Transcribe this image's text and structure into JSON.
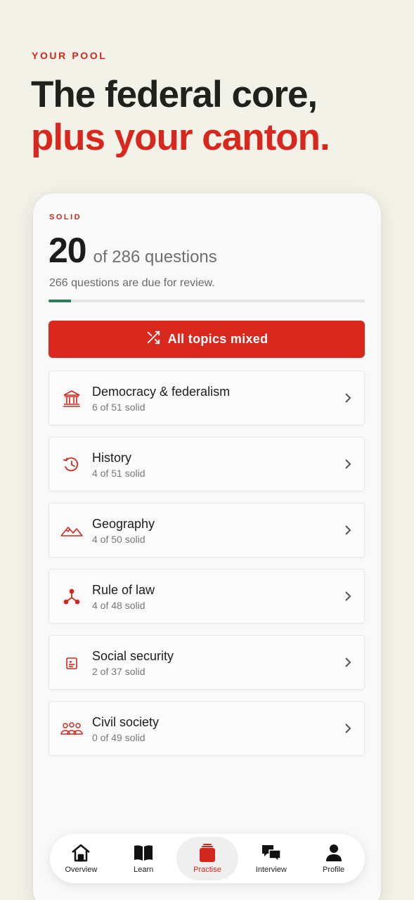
{
  "header": {
    "eyebrow": "YOUR POOL",
    "headline_line1": "The federal core,",
    "headline_line2": "plus your canton."
  },
  "summary": {
    "label": "SOLID",
    "solid_count": "20",
    "of_text": "of 286 questions",
    "due_text": "266 questions are due for review.",
    "progress_fraction": 0.07
  },
  "mix_button": {
    "label": "All topics mixed",
    "icon": "shuffle-icon"
  },
  "topics": [
    {
      "name": "Democracy & federalism",
      "sub": "6 of 51 solid",
      "icon": "building-columns-icon"
    },
    {
      "name": "History",
      "sub": "4 of 51 solid",
      "icon": "history-clock-icon"
    },
    {
      "name": "Geography",
      "sub": "4 of 50 solid",
      "icon": "mountains-icon"
    },
    {
      "name": "Rule of law",
      "sub": "4 of 48 solid",
      "icon": "network-nodes-icon"
    },
    {
      "name": "Social security",
      "sub": "2 of 37 solid",
      "icon": "card-heart-icon"
    },
    {
      "name": "Civil society",
      "sub": "0 of 49 solid",
      "icon": "people-group-icon"
    }
  ],
  "tabbar": [
    {
      "label": "Overview",
      "icon": "home-icon",
      "active": false
    },
    {
      "label": "Learn",
      "icon": "book-icon",
      "active": false
    },
    {
      "label": "Practise",
      "icon": "cards-icon",
      "active": true
    },
    {
      "label": "Interview",
      "icon": "chat-bubbles-icon",
      "active": false
    },
    {
      "label": "Profile",
      "icon": "person-icon",
      "active": false
    }
  ],
  "colors": {
    "accent": "#d9291f",
    "background": "#f3f2e8",
    "progress": "#2e7d5a"
  }
}
